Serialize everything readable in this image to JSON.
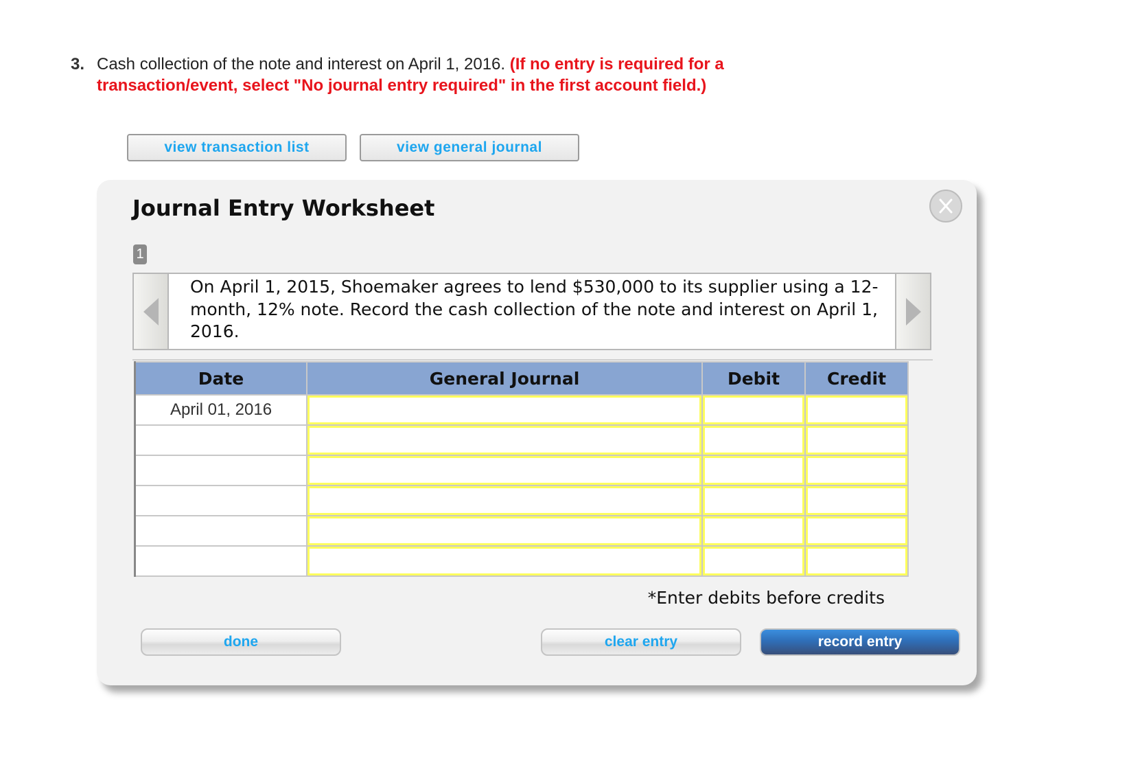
{
  "question": {
    "number": "3.",
    "text": "Cash collection of the note and interest on April 1, 2016.",
    "instruction_line1": "(If no entry is required for a",
    "instruction_line2": "transaction/event, select \"No journal entry required\" in the first account field.)"
  },
  "top_buttons": {
    "view_transaction_list": "view transaction list",
    "view_general_journal": "view general journal"
  },
  "worksheet": {
    "title": "Journal Entry Worksheet",
    "close_label": "X",
    "transaction_number": "1",
    "description": "On April 1, 2015, Shoemaker agrees to lend $530,000 to its supplier using a 12-month, 12% note. Record the cash collection of the note and interest on April 1, 2016.",
    "columns": [
      "Date",
      "General Journal",
      "Debit",
      "Credit"
    ],
    "rows": [
      {
        "date": "April 01, 2016",
        "account": "",
        "debit": "",
        "credit": ""
      },
      {
        "date": "",
        "account": "",
        "debit": "",
        "credit": ""
      },
      {
        "date": "",
        "account": "",
        "debit": "",
        "credit": ""
      },
      {
        "date": "",
        "account": "",
        "debit": "",
        "credit": ""
      },
      {
        "date": "",
        "account": "",
        "debit": "",
        "credit": ""
      },
      {
        "date": "",
        "account": "",
        "debit": "",
        "credit": ""
      }
    ],
    "note": "*Enter debits before credits",
    "buttons": {
      "done": "done",
      "clear_entry": "clear entry",
      "record_entry": "record entry"
    }
  },
  "colors": {
    "instruction_red": "#e8141c",
    "link_blue": "#1ea6ef",
    "header_blue": "#88a5d2",
    "input_highlight": "#fdfd5c",
    "record_button": "#2f6fb8"
  }
}
